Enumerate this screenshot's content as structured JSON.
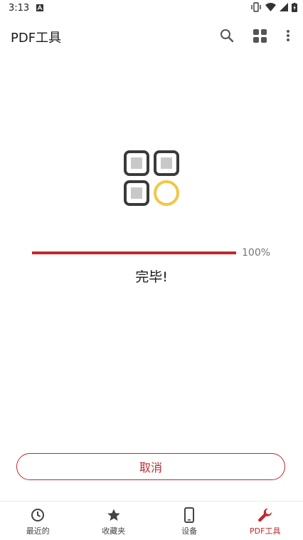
{
  "status_bar": {
    "time": "3:13"
  },
  "app_bar": {
    "title": "PDF工具"
  },
  "progress": {
    "percent_label": "100%",
    "fraction": 1.0,
    "status_text": "完毕!"
  },
  "actions": {
    "cancel_label": "取消"
  },
  "bottom_nav": {
    "items": [
      {
        "label": "最近的",
        "icon": "clock-icon"
      },
      {
        "label": "收藏夹",
        "icon": "star-icon"
      },
      {
        "label": "设备",
        "icon": "phone-icon"
      },
      {
        "label": "PDF工具",
        "icon": "wrench-icon",
        "active": true
      }
    ]
  },
  "colors": {
    "accent": "#c4262e",
    "logo_dark": "#3a3a3a",
    "logo_gray": "#c8c8c8",
    "logo_yellow": "#f2c744"
  }
}
